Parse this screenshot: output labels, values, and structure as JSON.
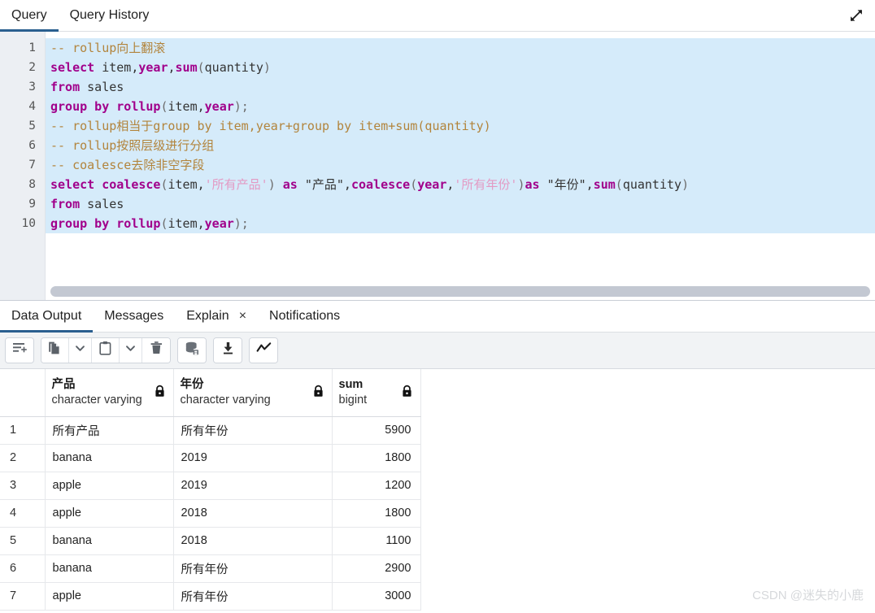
{
  "header": {
    "tabs": [
      {
        "label": "Query",
        "active": true
      },
      {
        "label": "Query History",
        "active": false
      }
    ],
    "expand_icon": "expand-diagonal-icon"
  },
  "editor": {
    "line_numbers": [
      "1",
      "2",
      "3",
      "4",
      "5",
      "6",
      "7",
      "8",
      "9",
      "10"
    ],
    "lines": [
      {
        "n": 1,
        "selected": true,
        "tokens": [
          {
            "t": "cm",
            "s": "-- rollup向上翻滚"
          }
        ]
      },
      {
        "n": 2,
        "selected": true,
        "tokens": [
          {
            "t": "kw",
            "s": "select"
          },
          {
            "t": "pl",
            "s": " item,"
          },
          {
            "t": "kw",
            "s": "year"
          },
          {
            "t": "pl",
            "s": ","
          },
          {
            "t": "fn",
            "s": "sum"
          },
          {
            "t": "op",
            "s": "("
          },
          {
            "t": "pl",
            "s": "quantity"
          },
          {
            "t": "op",
            "s": ")"
          }
        ]
      },
      {
        "n": 3,
        "selected": true,
        "tokens": [
          {
            "t": "kw",
            "s": "from"
          },
          {
            "t": "pl",
            "s": " sales"
          }
        ]
      },
      {
        "n": 4,
        "selected": true,
        "tokens": [
          {
            "t": "kw",
            "s": "group by rollup"
          },
          {
            "t": "op",
            "s": "("
          },
          {
            "t": "pl",
            "s": "item,"
          },
          {
            "t": "kw",
            "s": "year"
          },
          {
            "t": "op",
            "s": ");"
          }
        ]
      },
      {
        "n": 5,
        "selected": true,
        "tokens": [
          {
            "t": "cm",
            "s": "-- rollup相当于group by item,year+group by item+sum(quantity)"
          }
        ]
      },
      {
        "n": 6,
        "selected": true,
        "tokens": [
          {
            "t": "cm",
            "s": "-- rollup按照层级进行分组"
          }
        ]
      },
      {
        "n": 7,
        "selected": true,
        "tokens": [
          {
            "t": "cm",
            "s": "-- coalesce去除非空字段"
          }
        ]
      },
      {
        "n": 8,
        "selected": true,
        "tokens": [
          {
            "t": "kw",
            "s": "select"
          },
          {
            "t": "pl",
            "s": " "
          },
          {
            "t": "fn",
            "s": "coalesce"
          },
          {
            "t": "op",
            "s": "("
          },
          {
            "t": "pl",
            "s": "item,"
          },
          {
            "t": "st",
            "s": "'所有产品'"
          },
          {
            "t": "op",
            "s": ") "
          },
          {
            "t": "kw",
            "s": "as"
          },
          {
            "t": "pl",
            "s": " \"产品\","
          },
          {
            "t": "fn",
            "s": "coalesce"
          },
          {
            "t": "op",
            "s": "("
          },
          {
            "t": "kw",
            "s": "year"
          },
          {
            "t": "pl",
            "s": ","
          },
          {
            "t": "st",
            "s": "'所有年份'"
          },
          {
            "t": "op",
            "s": ")"
          },
          {
            "t": "kw",
            "s": "as"
          },
          {
            "t": "pl",
            "s": " \"年份\","
          },
          {
            "t": "fn",
            "s": "sum"
          },
          {
            "t": "op",
            "s": "("
          },
          {
            "t": "pl",
            "s": "quantity"
          },
          {
            "t": "op",
            "s": ")"
          }
        ]
      },
      {
        "n": 9,
        "selected": true,
        "tokens": [
          {
            "t": "kw",
            "s": "from"
          },
          {
            "t": "pl",
            "s": " sales"
          }
        ]
      },
      {
        "n": 10,
        "selected": true,
        "tokens": [
          {
            "t": "kw",
            "s": "group by rollup"
          },
          {
            "t": "op",
            "s": "("
          },
          {
            "t": "pl",
            "s": "item,"
          },
          {
            "t": "kw",
            "s": "year"
          },
          {
            "t": "op",
            "s": ");"
          }
        ]
      }
    ],
    "selection_color": "#d5ebfa",
    "scrollbar": "horizontal-scrollbar"
  },
  "output": {
    "tabs": [
      {
        "label": "Data Output",
        "active": true,
        "closable": false
      },
      {
        "label": "Messages",
        "active": false,
        "closable": false
      },
      {
        "label": "Explain",
        "active": false,
        "closable": true,
        "close_label": "×"
      },
      {
        "label": "Notifications",
        "active": false,
        "closable": false
      }
    ],
    "toolbar": [
      {
        "name": "add-row-button",
        "icon": "rows-plus-icon"
      },
      {
        "name": "copy-button",
        "icon": "copy-icon"
      },
      {
        "name": "copy-options-button",
        "icon": "chevron-down-icon"
      },
      {
        "name": "paste-button",
        "icon": "clipboard-icon"
      },
      {
        "name": "paste-options-button",
        "icon": "chevron-down-icon"
      },
      {
        "name": "delete-row-button",
        "icon": "trash-icon"
      },
      {
        "name": "save-data-changes-button",
        "icon": "database-save-icon"
      },
      {
        "name": "download-csv-button",
        "icon": "download-icon"
      },
      {
        "name": "graph-visualiser-button",
        "icon": "chart-line-icon"
      }
    ]
  },
  "results": {
    "columns": [
      {
        "name": "产品",
        "type": "character varying",
        "locked": true
      },
      {
        "name": "年份",
        "type": "character varying",
        "locked": true
      },
      {
        "name": "sum",
        "type": "bigint",
        "locked": true
      }
    ],
    "rows": [
      {
        "n": "1",
        "c0": "所有产品",
        "c1": "所有年份",
        "c2": "5900"
      },
      {
        "n": "2",
        "c0": "banana",
        "c1": "2019",
        "c2": "1800"
      },
      {
        "n": "3",
        "c0": "apple",
        "c1": "2019",
        "c2": "1200"
      },
      {
        "n": "4",
        "c0": "apple",
        "c1": "2018",
        "c2": "1800"
      },
      {
        "n": "5",
        "c0": "banana",
        "c1": "2018",
        "c2": "1100"
      },
      {
        "n": "6",
        "c0": "banana",
        "c1": "所有年份",
        "c2": "2900"
      },
      {
        "n": "7",
        "c0": "apple",
        "c1": "所有年份",
        "c2": "3000"
      }
    ]
  },
  "watermark": {
    "text": "CSDN @迷失的小鹿"
  },
  "colors": {
    "accent": "#2a5f8f",
    "keyword": "#a1008b",
    "comment": "#b2843c",
    "string": "#e39ac4",
    "selection": "#d5ebfa"
  }
}
